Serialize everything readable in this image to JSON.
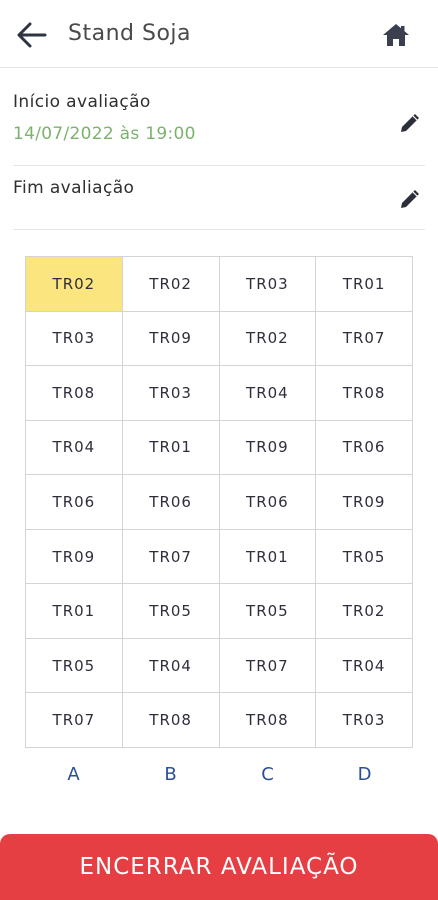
{
  "header": {
    "title": "Stand Soja",
    "back_icon": "arrow-left-icon",
    "home_icon": "home-icon"
  },
  "evaluation": {
    "start_label": "Início avaliação",
    "start_value": "14/07/2022 às 19:00",
    "end_label": "Fim avaliação",
    "end_value": "",
    "edit_icon": "pencil-icon"
  },
  "grid": {
    "columns": [
      "A",
      "B",
      "C",
      "D"
    ],
    "rows": [
      [
        "TR02",
        "TR02",
        "TR03",
        "TR01"
      ],
      [
        "TR03",
        "TR09",
        "TR02",
        "TR07"
      ],
      [
        "TR08",
        "TR03",
        "TR04",
        "TR08"
      ],
      [
        "TR04",
        "TR01",
        "TR09",
        "TR06"
      ],
      [
        "TR06",
        "TR06",
        "TR06",
        "TR09"
      ],
      [
        "TR09",
        "TR07",
        "TR01",
        "TR05"
      ],
      [
        "TR01",
        "TR05",
        "TR05",
        "TR02"
      ],
      [
        "TR05",
        "TR04",
        "TR07",
        "TR04"
      ],
      [
        "TR07",
        "TR08",
        "TR08",
        "TR03"
      ]
    ],
    "selected_cell": "A1"
  },
  "actions": {
    "finish_label": "ENCERRAR AVALIAÇÃO"
  },
  "colors": {
    "accent_red": "#e53e43",
    "date_green": "#7cb26e",
    "selected_yellow": "#fbe57f",
    "column_label_blue": "#2a4f9a"
  }
}
